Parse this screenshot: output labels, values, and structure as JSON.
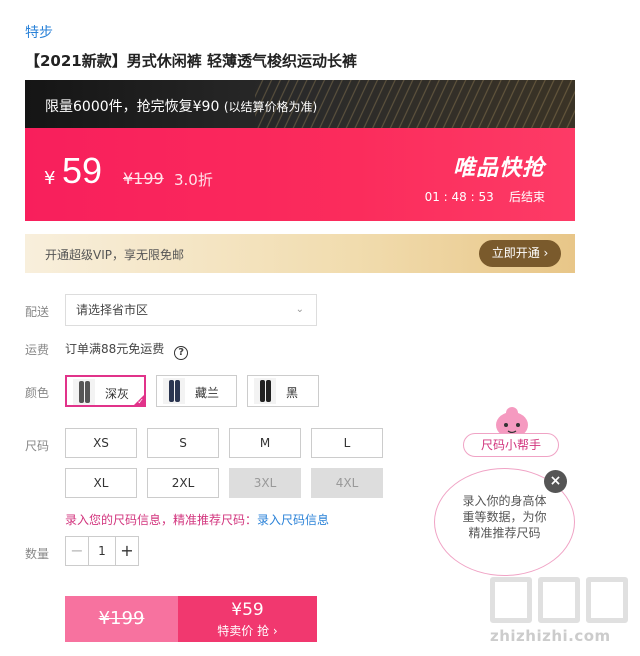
{
  "brand": "特步",
  "product_title": "【2021新款】男式休闲裤 轻薄透气梭织运动长裤",
  "promo": {
    "limit_text": "限量6000件，抢完恢复¥90",
    "limit_note": "(以结算价格为准)",
    "currency": "¥",
    "price": "59",
    "original_price": "¥199",
    "discount": "3.0折",
    "flash_title": "唯品快抢",
    "countdown": "01 : 48 : 53",
    "countdown_suffix": "后结束"
  },
  "vip": {
    "text": "开通超级VIP，享无限免邮",
    "button": "立即开通 ›"
  },
  "labels": {
    "delivery": "配送",
    "shipping": "运费",
    "color": "颜色",
    "size": "尺码",
    "quantity": "数量"
  },
  "delivery_select": {
    "placeholder": "请选择省市区"
  },
  "shipping_text": "订单满88元免运费",
  "colors": [
    {
      "name": "深灰",
      "selected": true,
      "swatch": "#555555"
    },
    {
      "name": "藏兰",
      "selected": false,
      "swatch": "#2a3550"
    },
    {
      "name": "黑",
      "selected": false,
      "swatch": "#222222"
    }
  ],
  "sizes": [
    {
      "label": "XS",
      "available": true
    },
    {
      "label": "S",
      "available": true
    },
    {
      "label": "M",
      "available": true
    },
    {
      "label": "L",
      "available": true
    },
    {
      "label": "XL",
      "available": true
    },
    {
      "label": "2XL",
      "available": true
    },
    {
      "label": "3XL",
      "available": false
    },
    {
      "label": "4XL",
      "available": false
    }
  ],
  "size_hint": {
    "text": "录入您的尺码信息，精准推荐尺码：",
    "link": "录入尺码信息"
  },
  "quantity": {
    "minus": "−",
    "value": "1",
    "plus": "+"
  },
  "buy": {
    "original": "¥199",
    "price": "¥59",
    "label": "特卖价 抢 ›"
  },
  "size_helper": {
    "tag": "尺码小帮手",
    "bubble_line1": "录入你的身高体",
    "bubble_line2": "重等数据，为你",
    "bubble_line3": "精准推荐尺码",
    "close": "×"
  },
  "watermark": {
    "url": "zhizhizhi.com"
  },
  "colors_theme": {
    "accent_pink": "#f81f5c",
    "link_blue": "#2a82d8"
  }
}
